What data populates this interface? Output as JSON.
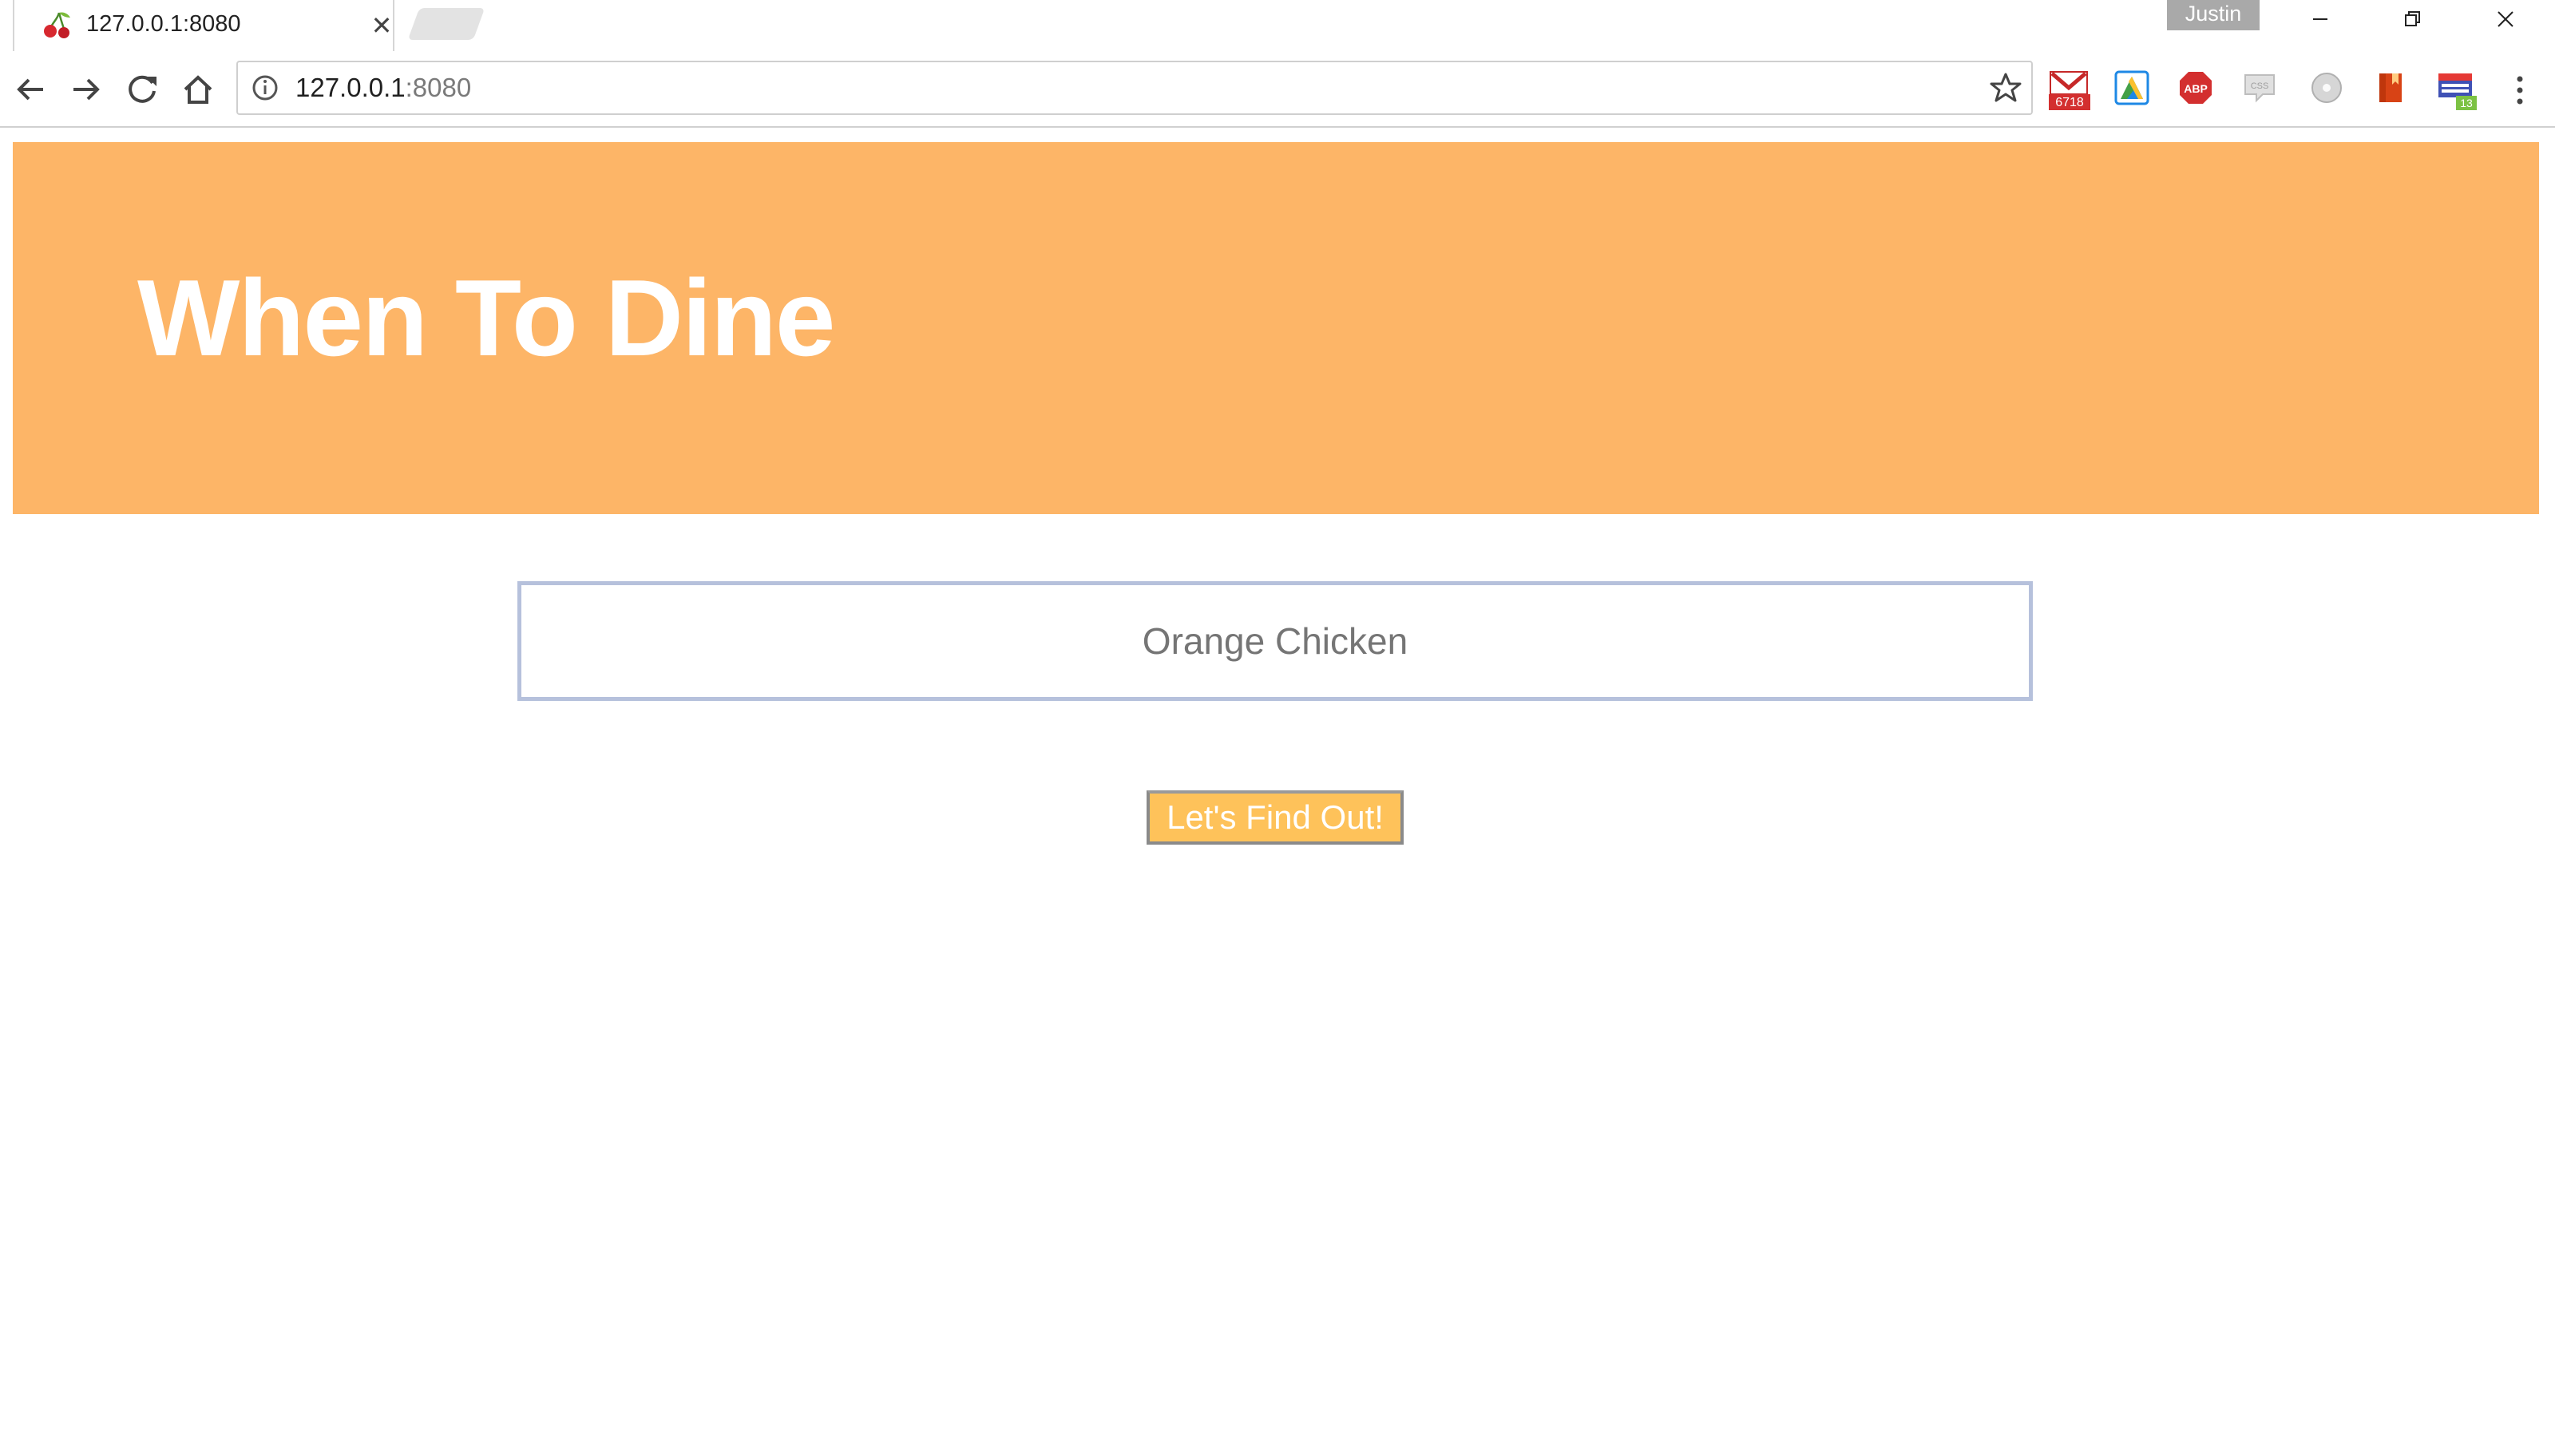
{
  "browser": {
    "tab": {
      "title": "127.0.0.1:8080",
      "favicon": "cherry-icon",
      "close_icon": "close-icon"
    },
    "new_tab_icon": "new-tab-icon",
    "profile_name": "Justin",
    "window_controls": {
      "minimize_icon": "minimize-icon",
      "restore_icon": "restore-icon",
      "close_icon": "close-icon"
    },
    "nav": {
      "back_icon": "back-arrow-icon",
      "forward_icon": "forward-arrow-icon",
      "reload_icon": "reload-icon",
      "home_icon": "home-icon"
    },
    "address_bar": {
      "host": "127.0.0.1",
      "port": ":8080",
      "info_icon": "info-icon",
      "bookmark_icon": "star-icon"
    },
    "extensions": [
      {
        "name": "gmail-icon",
        "badge": "6718",
        "badge_color": "#d32f2f"
      },
      {
        "name": "google-drive-icon"
      },
      {
        "name": "adblock-plus-icon",
        "label": "ABP"
      },
      {
        "name": "css-viewer-icon",
        "label": "CSS"
      },
      {
        "name": "disc-icon"
      },
      {
        "name": "bookmark-ext-icon"
      },
      {
        "name": "tab-manager-icon",
        "badge": "13",
        "badge_color": "#7cc243"
      }
    ],
    "menu_icon": "more-vert-icon"
  },
  "page": {
    "title": "When To Dine",
    "search": {
      "value": "Orange Chicken",
      "placeholder": ""
    },
    "submit_label": "Let's Find Out!"
  },
  "colors": {
    "banner": "#fdb567",
    "button": "#fec25a",
    "input_border": "#b6c1dc"
  }
}
